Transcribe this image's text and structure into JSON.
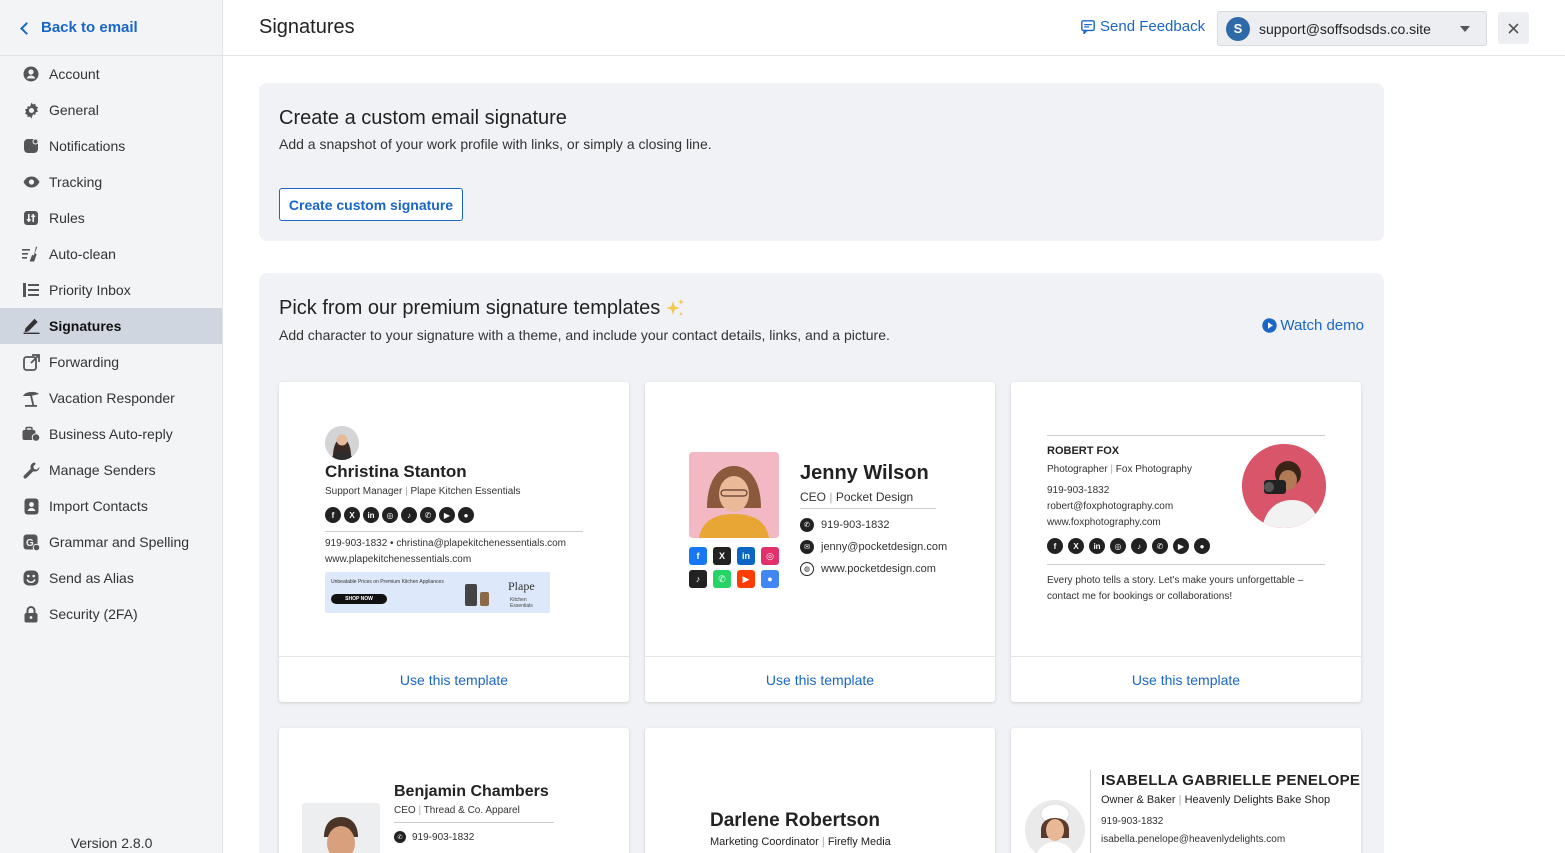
{
  "sidebar": {
    "back_label": "Back to email",
    "items": [
      {
        "label": "Account",
        "icon": "user-circle-icon"
      },
      {
        "label": "General",
        "icon": "gear-icon"
      },
      {
        "label": "Notifications",
        "icon": "bell-icon"
      },
      {
        "label": "Tracking",
        "icon": "eye-icon"
      },
      {
        "label": "Rules",
        "icon": "rules-icon"
      },
      {
        "label": "Auto-clean",
        "icon": "broom-icon"
      },
      {
        "label": "Priority Inbox",
        "icon": "priority-list-icon"
      },
      {
        "label": "Signatures",
        "icon": "pen-icon",
        "active": true
      },
      {
        "label": "Forwarding",
        "icon": "forward-icon"
      },
      {
        "label": "Vacation Responder",
        "icon": "umbrella-icon"
      },
      {
        "label": "Business Auto-reply",
        "icon": "briefcase-icon"
      },
      {
        "label": "Manage Senders",
        "icon": "wrench-icon"
      },
      {
        "label": "Import Contacts",
        "icon": "contacts-icon"
      },
      {
        "label": "Grammar and Spelling",
        "icon": "grammar-icon"
      },
      {
        "label": "Send as Alias",
        "icon": "smile-icon"
      },
      {
        "label": "Security (2FA)",
        "icon": "lock-icon"
      }
    ],
    "version": "Version 2.8.0"
  },
  "header": {
    "title": "Signatures",
    "feedback_label": "Send Feedback",
    "account_initial": "S",
    "account_email": "support@soffsodsds.co.site"
  },
  "custom": {
    "title": "Create a custom email signature",
    "subtitle": "Add a snapshot of your work profile with links, or simply a closing line.",
    "button": "Create custom signature"
  },
  "premium": {
    "title": "Pick from our premium signature templates",
    "subtitle": "Add character to your signature with a theme, and include your contact details, links, and a picture.",
    "watch_demo": "Watch demo",
    "use_template": "Use this template"
  },
  "templates": {
    "t1": {
      "name": "Christina Stanton",
      "role": "Support Manager",
      "company": "Plape Kitchen Essentials",
      "contact_line": "919-903-1832 • christina@plapekitchenessentials.com",
      "website": "www.plapekitchenessentials.com",
      "banner_text": "Unbeatable Prices on Premium Kitchen Appliances",
      "banner_cta": "SHOP NOW",
      "banner_brand": "Plape",
      "banner_brand_sub": "Kitchen Essentials"
    },
    "t2": {
      "name": "Jenny Wilson",
      "role": "CEO",
      "company": "Pocket Design",
      "phone": "919-903-1832",
      "email": "jenny@pocketdesign.com",
      "website": "www.pocketdesign.com"
    },
    "t3": {
      "name": "ROBERT FOX",
      "role": "Photographer",
      "company": "Fox Photography",
      "phone": "919-903-1832",
      "email": "robert@foxphotography.com",
      "website": "www.foxphotography.com",
      "tagline": "Every photo tells a story. Let's make yours unforgettable – contact me for bookings or collaborations!"
    },
    "t4": {
      "name": "Benjamin Chambers",
      "role": "CEO",
      "company": "Thread & Co. Apparel",
      "phone": "919-903-1832"
    },
    "t5": {
      "name": "Darlene Robertson",
      "role": "Marketing Coordinator",
      "company": "Firefly Media"
    },
    "t6": {
      "name": "ISABELLA GABRIELLE PENELOPE",
      "role": "Owner & Baker",
      "company": "Heavenly Delights Bake Shop",
      "phone": "919-903-1832",
      "email": "isabella.penelope@heavenlydelights.com"
    }
  },
  "colors": {
    "accent": "#1a66c7",
    "sidebar_bg": "#f3f4f6",
    "panel_bg": "#f0f2f5",
    "active_bg": "#cfd6df"
  }
}
